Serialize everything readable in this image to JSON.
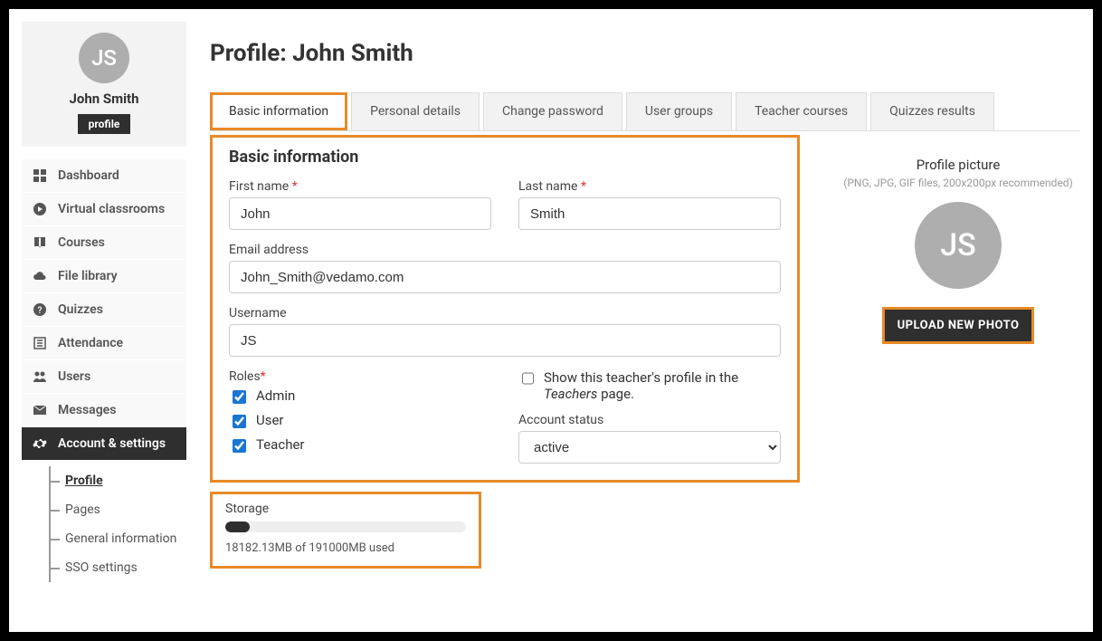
{
  "sidebar": {
    "avatar_initials": "JS",
    "name": "John Smith",
    "badge": "profile",
    "items": [
      {
        "label": "Dashboard"
      },
      {
        "label": "Virtual classrooms"
      },
      {
        "label": "Courses"
      },
      {
        "label": "File library"
      },
      {
        "label": "Quizzes"
      },
      {
        "label": "Attendance"
      },
      {
        "label": "Users"
      },
      {
        "label": "Messages"
      },
      {
        "label": "Account & settings"
      }
    ],
    "subnav": [
      {
        "label": "Profile"
      },
      {
        "label": "Pages"
      },
      {
        "label": "General information"
      },
      {
        "label": "SSO settings"
      }
    ]
  },
  "page": {
    "title": "Profile: John Smith"
  },
  "tabs": [
    {
      "label": "Basic information"
    },
    {
      "label": "Personal details"
    },
    {
      "label": "Change password"
    },
    {
      "label": "User groups"
    },
    {
      "label": "Teacher courses"
    },
    {
      "label": "Quizzes results"
    }
  ],
  "form": {
    "heading": "Basic information",
    "first_name_label": "First name",
    "first_name": "John",
    "last_name_label": "Last name",
    "last_name": "Smith",
    "email_label": "Email address",
    "email": "John_Smith@vedamo.com",
    "username_label": "Username",
    "username": "JS",
    "roles_label": "Roles",
    "roles": [
      {
        "label": "Admin",
        "checked": true
      },
      {
        "label": "User",
        "checked": true
      },
      {
        "label": "Teacher",
        "checked": true
      }
    ],
    "show_teacher_prefix": "Show this teacher's profile in the ",
    "show_teacher_em": "Teachers",
    "show_teacher_suffix": " page.",
    "status_label": "Account status",
    "status_value": "active"
  },
  "storage": {
    "title": "Storage",
    "text": "18182.13MB of 191000MB used",
    "percent": "10%"
  },
  "picture": {
    "title": "Profile picture",
    "hint": "(PNG, JPG, GIF files, 200x200px recommended)",
    "initials": "JS",
    "button": "UPLOAD NEW PHOTO"
  }
}
